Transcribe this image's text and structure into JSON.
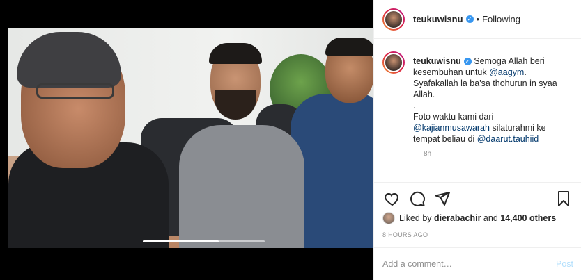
{
  "video": {
    "progress": 0.62
  },
  "header": {
    "username": "teukuwisnu",
    "separator": "•",
    "follow_status": "Following"
  },
  "caption": {
    "username": "teukuwisnu",
    "line1": "Semoga Allah beri kesembuhan untuk ",
    "mention1": "@aagym",
    "line1_end": ".",
    "line2": "Syafakallah la ba'sa thohurun in syaa Allah.",
    "line3": ".",
    "line4": "Foto waktu kami dari ",
    "mention2": "@kajianmusawarah",
    "line4_mid": " silaturahmi ke tempat beliau di ",
    "mention3": "@daarut.tauhiid",
    "time": "8h"
  },
  "likes": {
    "prefix": "Liked by ",
    "user": "dierabachir",
    "mid": " and ",
    "count": "14,400 others"
  },
  "posted": "8 HOURS AGO",
  "comment_box": {
    "placeholder": "Add a comment…",
    "post_label": "Post"
  }
}
